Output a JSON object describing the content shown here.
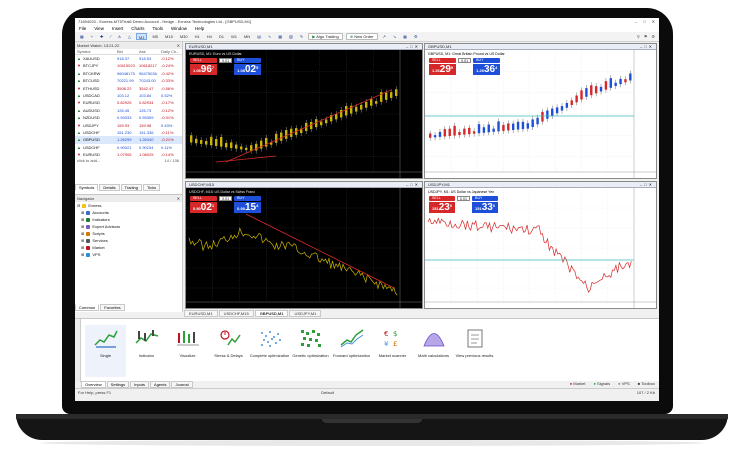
{
  "app": {
    "title": "71694020 - Exness-MT5Trial6 Demo Account - Hedge - Exness Technologies Ltd - [GBPUSD,M1]"
  },
  "menu": [
    "File",
    "View",
    "Insert",
    "Charts",
    "Tools",
    "Window",
    "Help"
  ],
  "toolbar": {
    "timeframes": [
      "M1",
      "M5",
      "M15",
      "M30",
      "H1",
      "H4",
      "D1",
      "W1",
      "MN"
    ],
    "active_timeframe": "M1",
    "algo_trading": "Algo Trading",
    "new_order": "New Order"
  },
  "market_watch": {
    "title": "Market Watch: 13:21:22",
    "headers": [
      "Symbol",
      "Bid",
      "Ask",
      "Daily Ch..."
    ],
    "rows": [
      {
        "symbol": "XAUUSD",
        "bid": "918.37",
        "ask": "918.53",
        "change": "-0.12%",
        "dir": "up"
      },
      {
        "symbol": "BTCJPY",
        "bid": "10615023",
        "ask": "10618217",
        "change": "-0.24%",
        "dir": "down"
      },
      {
        "symbol": "BTCKRW",
        "bid": "96048175",
        "ask": "96475036",
        "change": "-0.42%",
        "dir": "up"
      },
      {
        "symbol": "BTCUSD",
        "bid": "70221.99",
        "ask": "70243.00",
        "change": "-0.33%",
        "dir": "up"
      },
      {
        "symbol": "ETHUSD",
        "bid": "3508.22",
        "ask": "3542.47",
        "change": "-0.56%",
        "dir": "down"
      },
      {
        "symbol": "USDCAD",
        "bid": "103.12",
        "ask": "103.84",
        "change": "0.52%",
        "dir": "up"
      },
      {
        "symbol": "EURUSD",
        "bid": "0.82925",
        "ask": "0.82934",
        "change": "-0.17%",
        "dir": "down"
      },
      {
        "symbol": "AUDUSD",
        "bid": "126.45",
        "ask": "126.73",
        "change": "-0.12%",
        "dir": "up"
      },
      {
        "symbol": "NZDUSD",
        "bid": "0.59333",
        "ask": "0.59359",
        "change": "-0.31%",
        "dir": "up"
      },
      {
        "symbol": "USDJPY",
        "bid": "159.93",
        "ask": "159.98",
        "change": "0.43%",
        "dir": "down"
      },
      {
        "symbol": "USDCHF",
        "bid": "151.230",
        "ask": "151.336",
        "change": "-0.11%",
        "dir": "up"
      },
      {
        "symbol": "GBPUSD",
        "bid": "1.26299",
        "ask": "1.26340",
        "change": "-0.21%",
        "dir": "up"
      },
      {
        "symbol": "USDCHF",
        "bid": "0.90021",
        "ask": "0.90154",
        "change": "0.11%",
        "dir": "up"
      },
      {
        "symbol": "EURUSD",
        "bid": "1.07905",
        "ask": "1.08025",
        "change": "-0.14%",
        "dir": "down"
      }
    ],
    "footer_hint": "click to add...",
    "footer_count": "14 / 136",
    "tabs": [
      "Symbols",
      "Details",
      "Trading",
      "Ticks"
    ]
  },
  "navigator": {
    "title": "Navigator",
    "items": [
      "Exness",
      "Accounts",
      "Indicators",
      "Expert Advisors",
      "Scripts",
      "Services",
      "Market",
      "VPS"
    ],
    "tabs": [
      "Common",
      "Favorites"
    ]
  },
  "charts": [
    {
      "title": "EURUSD,M1",
      "info": "EURUSD, M1: Euro vs US Dollar",
      "lot": "0.01",
      "sell_small": "1.08",
      "sell_big": "96",
      "sell_sup": "7",
      "buy_small": "1.08",
      "buy_big": "02",
      "buy_sup": "5"
    },
    {
      "title": "GBPUSD,M1",
      "info": "GBPUSD, M1: Great Britain Pound vs US Dollar",
      "lot": "0.01",
      "sell_small": "1.26",
      "sell_big": "29",
      "sell_sup": "9",
      "buy_small": "1.26",
      "buy_big": "36",
      "buy_sup": "4"
    },
    {
      "title": "USDCHF,M15",
      "info": "USDCHF, M15: US Dollar vs Swiss Franc",
      "lot": "0.01",
      "sell_small": "0.90",
      "sell_big": "02",
      "sell_sup": "1",
      "buy_small": "0.90",
      "buy_big": "15",
      "buy_sup": "4"
    },
    {
      "title": "USDJPY,M1",
      "info": "USDJPY, M1: US Dollar vs Japanese Yen",
      "lot": "0.01",
      "sell_small": "151",
      "sell_big": "23",
      "sell_sup": "0",
      "buy_small": "151",
      "buy_big": "33",
      "buy_sup": "6"
    }
  ],
  "chart_tabs": [
    "EURUSD,M1",
    "USDCHF,M15",
    "GBPUSD,M1",
    "USDJPY,M1"
  ],
  "tester": {
    "modes": [
      "Single",
      "Indicator",
      "Visualize",
      "Stress & Delays",
      "Complete optimization",
      "Genetic optimization",
      "Forward optimization",
      "Market scanner",
      "Math calculations",
      "View previous results"
    ],
    "tabs": [
      "Overview",
      "Settings",
      "Inputs",
      "Agents",
      "Journal"
    ],
    "right_items": [
      "Market",
      "Signals",
      "VPS",
      "Toolbox"
    ]
  },
  "status": {
    "help": "For Help, press F1",
    "profile": "Default",
    "traffic": "107 / 2 Kb"
  }
}
